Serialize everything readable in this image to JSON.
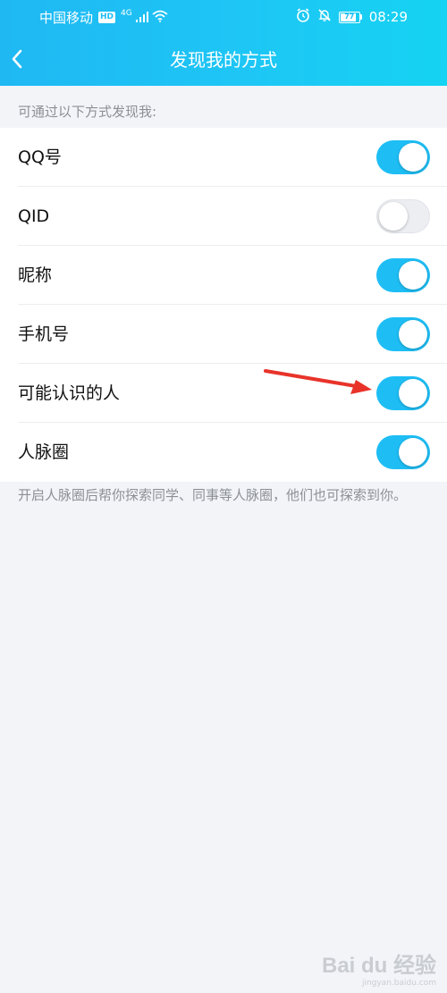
{
  "status_bar": {
    "carrier": "中国移动",
    "hd_badge": "HD",
    "network": "4G",
    "battery_level": "77",
    "time": "08:29"
  },
  "header": {
    "title": "发现我的方式"
  },
  "section": {
    "header": "可通过以下方式发现我:"
  },
  "options": [
    {
      "label": "QQ号",
      "enabled": true
    },
    {
      "label": "QID",
      "enabled": false
    },
    {
      "label": "昵称",
      "enabled": true
    },
    {
      "label": "手机号",
      "enabled": true
    },
    {
      "label": "可能认识的人",
      "enabled": true
    },
    {
      "label": "人脉圈",
      "enabled": true
    }
  ],
  "footer_note": "开启人脉圈后帮你探索同学、同事等人脉圈，他们也可探索到你。",
  "watermark": {
    "brand": "Bai du 经验",
    "url": "jingyan.baidu.com"
  },
  "colors": {
    "header_gradient_start": "#1fb8f3",
    "header_gradient_end": "#15d3f2",
    "switch_on": "#1ebef5",
    "switch_off": "#eceef2",
    "annotation_arrow": "#e8332a"
  }
}
